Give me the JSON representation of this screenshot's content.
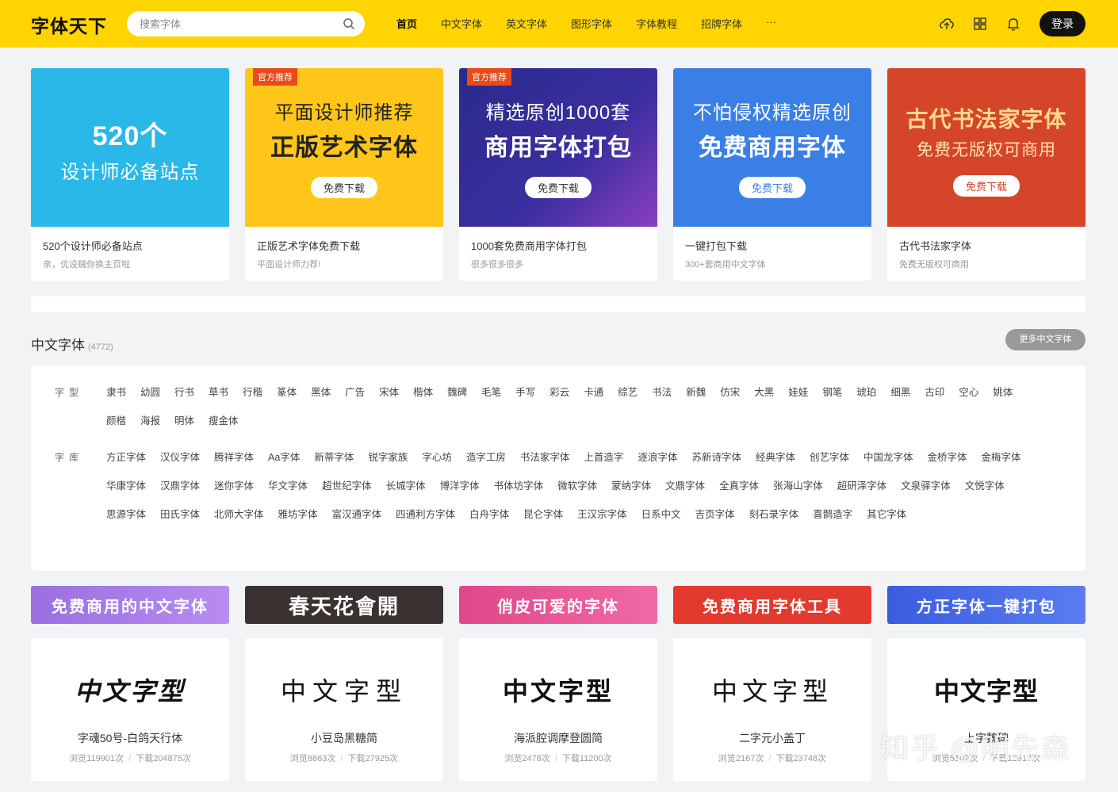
{
  "header": {
    "logo": "字体天下",
    "search_placeholder": "搜索字体",
    "nav": [
      "首页",
      "中文字体",
      "英文字体",
      "图形字体",
      "字体教程",
      "招牌字体",
      "···"
    ],
    "login": "登录",
    "icons": [
      "upload-icon",
      "grid-icon",
      "bell-icon"
    ]
  },
  "banners": [
    {
      "line1": "520个",
      "line2": "设计师必备站点",
      "pill": "",
      "badge": "",
      "title": "520个设计师必备站点",
      "sub": "亲，优设贼你换主页啦",
      "color": "#29b8e8"
    },
    {
      "line1": "平面设计师推荐",
      "line2": "正版艺术字体",
      "pill": "免费下载",
      "badge": "官方推荐",
      "title": "正版艺术字体免费下载",
      "sub": "平面设计师力荐!",
      "color": "#ffc61a"
    },
    {
      "line1": "精选原创1000套",
      "line2": "商用字体打包",
      "pill": "免费下载",
      "badge": "官方推荐",
      "title": "1000套免费商用字体打包",
      "sub": "很多很多很多",
      "color": "#2a2a8c"
    },
    {
      "line1": "不怕侵权精选原创",
      "line2": "免费商用字体",
      "pill": "免费下载",
      "badge": "",
      "title": "一键打包下载",
      "sub": "300+套商用中文字体",
      "color": "#3a7fe6"
    },
    {
      "line1": "古代书法家字体",
      "line2": "免费无版权可商用",
      "pill": "免费下载",
      "badge": "",
      "title": "古代书法家字体",
      "sub": "免费无版权可商用",
      "color": "#d4452a"
    }
  ],
  "section": {
    "title": "中文字体",
    "count": "(4772)",
    "more": "更多中文字体"
  },
  "filters": {
    "type_label": "字型",
    "types": [
      "隶书",
      "幼圆",
      "行书",
      "草书",
      "行楷",
      "篆体",
      "黑体",
      "广告",
      "宋体",
      "楷体",
      "魏碑",
      "毛笔",
      "手写",
      "彩云",
      "卡通",
      "综艺",
      "书法",
      "新魏",
      "仿宋",
      "大黑",
      "娃娃",
      "钢笔",
      "琥珀",
      "细黑",
      "古印",
      "空心",
      "姚体",
      "颜楷",
      "海报",
      "明体",
      "瘦金体"
    ],
    "lib_label": "字库",
    "libs": [
      "方正字体",
      "汉仪字体",
      "腾祥字体",
      "Aa字体",
      "新蒂字体",
      "锐字家族",
      "字心坊",
      "造字工房",
      "书法家字体",
      "上首造字",
      "逐浪字体",
      "苏新诗字体",
      "经典字体",
      "创艺字体",
      "中国龙字体",
      "金桥字体",
      "金梅字体",
      "华康字体",
      "汉鼎字体",
      "迷你字体",
      "华文字体",
      "超世纪字体",
      "长城字体",
      "博洋字体",
      "书体坊字体",
      "微软字体",
      "蒙纳字体",
      "文鼎字体",
      "全真字体",
      "张海山字体",
      "超研泽字体",
      "文泉驿字体",
      "文悦字体",
      "思源字体",
      "田氏字体",
      "北师大字体",
      "雅坊字体",
      "富汉通字体",
      "四通利方字体",
      "白舟字体",
      "昆仑字体",
      "王汉宗字体",
      "日系中文",
      "吉页字体",
      "刻石录字体",
      "喜鹊造字",
      "其它字体"
    ]
  },
  "categories": [
    {
      "label": "免费商用的中文字体",
      "color": "#9b6fe0"
    },
    {
      "label": "春天花會開",
      "color": "#3a3230"
    },
    {
      "label": "俏皮可爱的字体",
      "color": "#e0478a"
    },
    {
      "label": "免费商用字体工具",
      "color": "#e23a2e"
    },
    {
      "label": "方正字体一键打包",
      "color": "#3a5de0"
    }
  ],
  "fonts": [
    {
      "sample": "中文字型",
      "name": "字魂50号-白鸽天行体",
      "views": "浏览119901次",
      "downloads": "下载204875次"
    },
    {
      "sample": "中文字型",
      "name": "小豆岛黑糖简",
      "views": "浏览8863次",
      "downloads": "下载27925次"
    },
    {
      "sample": "中文字型",
      "name": "海派腔调摩登圆简",
      "views": "浏览2478次",
      "downloads": "下载11200次"
    },
    {
      "sample": "中文字型",
      "name": "二字元小盖丁",
      "views": "浏览2167次",
      "downloads": "下载23748次"
    },
    {
      "sample": "中文字型",
      "name": "上字魏碑",
      "views": "浏览5102次",
      "downloads": "下载12917次"
    }
  ],
  "watermark": "知乎 @明先森"
}
